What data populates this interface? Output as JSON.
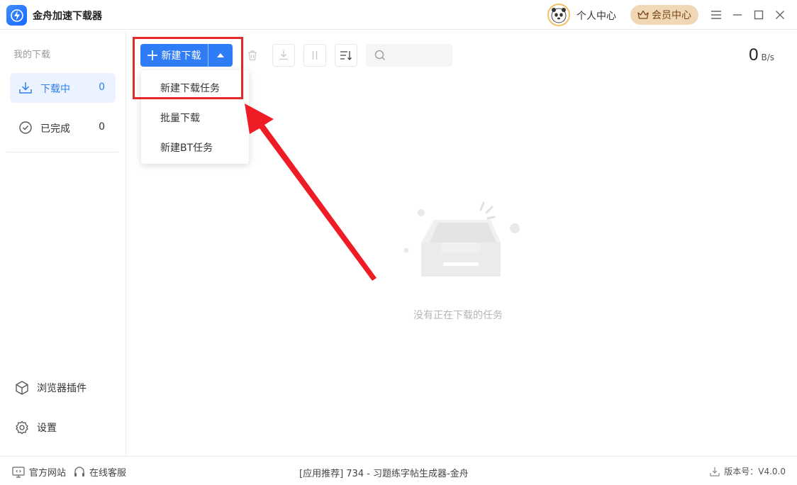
{
  "app": {
    "title": "金舟加速下载器"
  },
  "header": {
    "profile_label": "个人中心",
    "vip_label": "会员中心"
  },
  "sidebar": {
    "section_title": "我的下载",
    "items": [
      {
        "label": "下载中",
        "count": "0",
        "icon": "download-icon",
        "active": true
      },
      {
        "label": "已完成",
        "count": "0",
        "icon": "check-circle-icon",
        "active": false
      }
    ],
    "bottom": [
      {
        "label": "浏览器插件",
        "icon": "cube-icon"
      },
      {
        "label": "设置",
        "icon": "gear-icon"
      }
    ]
  },
  "toolbar": {
    "new_download_label": "新建下载",
    "search_placeholder": "",
    "speed_value": "0",
    "speed_unit": "B/s"
  },
  "dropdown": {
    "items": [
      "新建下载任务",
      "批量下载",
      "新建BT任务"
    ]
  },
  "main": {
    "empty_message": "没有正在下载的任务"
  },
  "statusbar": {
    "website_label": "官方网站",
    "support_label": "在线客服",
    "recommend_text": "[应用推荐]  734 - 习题练字帖生成器-金舟",
    "version_label": "版本号：V4.0.0"
  },
  "colors": {
    "accent": "#2f7df6",
    "highlight": "#e5282c",
    "vip_bg": "#f0d7b6",
    "active_bg": "#eaf3ff"
  }
}
